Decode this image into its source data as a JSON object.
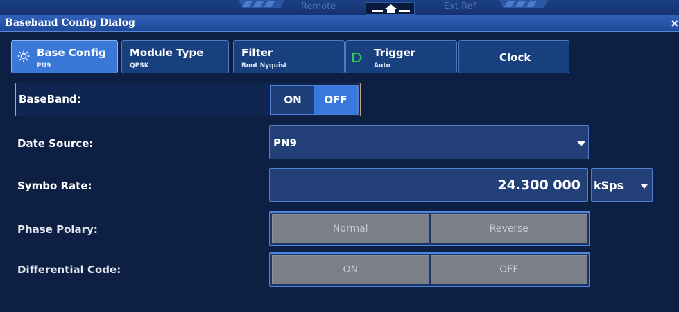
{
  "status_bar": {
    "remote": "Remote",
    "ext_ref": "Ext Ref",
    "home_icon": "home-icon"
  },
  "dialog": {
    "title": "Baseband Config Dialog",
    "close": "×"
  },
  "tabs": [
    {
      "label": "Base Config",
      "sub": "PN9",
      "icon": "gear-icon",
      "active": true
    },
    {
      "label": "Module Type",
      "sub": "QPSK",
      "active": false
    },
    {
      "label": "Filter",
      "sub": "Root Nyquist",
      "active": false
    },
    {
      "label": "Trigger",
      "sub": "Auto",
      "icon": "trigger-icon",
      "active": false
    },
    {
      "label": "Clock",
      "sub": "",
      "active": false
    }
  ],
  "baseband": {
    "label": "BaseBand:",
    "on": "ON",
    "off": "OFF",
    "selected": "OFF"
  },
  "data_source": {
    "label": "Date Source:",
    "value": "PN9"
  },
  "symbol_rate": {
    "label": "Symbo Rate:",
    "value": "24.300 000",
    "unit": "kSps"
  },
  "phase_polarity": {
    "label": "Phase Polary:",
    "option_a": "Normal",
    "option_b": "Reverse"
  },
  "differential_code": {
    "label": "Differential Code:",
    "option_a": "ON",
    "option_b": "OFF"
  },
  "colors": {
    "background": "#0d1f42",
    "active_tab": "#3a78d8",
    "accent": "#3978dd",
    "trigger_icon": "#33e04a"
  }
}
